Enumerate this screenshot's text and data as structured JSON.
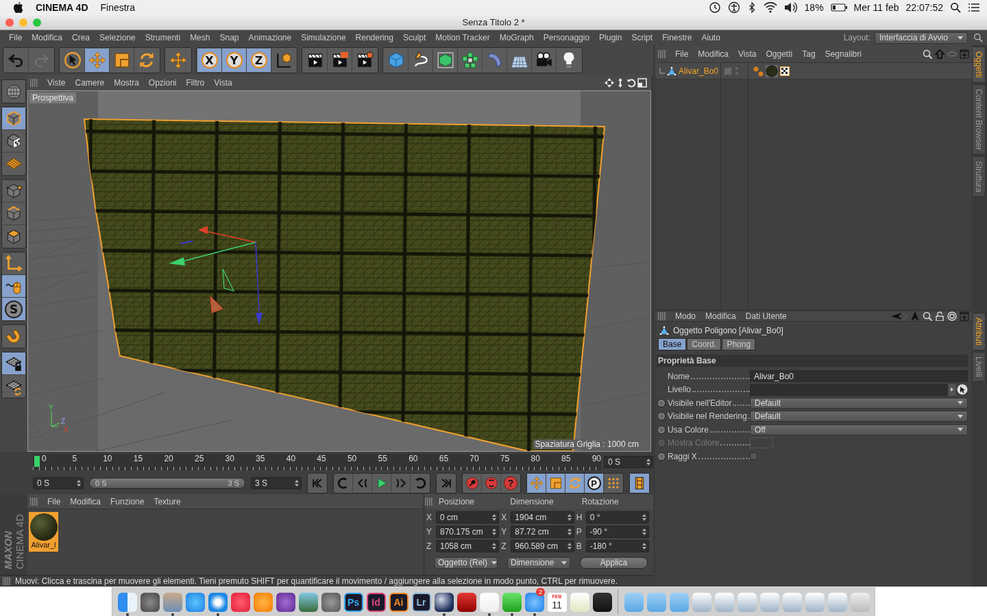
{
  "menubar": {
    "app_name": "CINEMA 4D",
    "menus": [
      "Finestra"
    ],
    "battery": "18%",
    "date": "Mer 11 feb",
    "time": "22:07:52"
  },
  "window": {
    "title": "Senza Titolo 2 *"
  },
  "menu": [
    "File",
    "Modifica",
    "Crea",
    "Selezione",
    "Strumenti",
    "Mesh",
    "Snap",
    "Animazione",
    "Simulazione",
    "Rendering",
    "Sculpt",
    "Motion Tracker",
    "MoGraph",
    "Personaggio",
    "Plugin",
    "Script",
    "Finestre",
    "Aiuto"
  ],
  "layout": {
    "label": "Layout:",
    "value": "Interfaccia di Avvio"
  },
  "toolbar": [
    [
      {
        "kind": "undo",
        "selected": false,
        "disabled": false
      },
      {
        "kind": "redo",
        "selected": false,
        "disabled": true
      }
    ],
    [
      {
        "kind": "select",
        "selected": false,
        "disabled": false
      },
      {
        "kind": "move",
        "selected": true,
        "disabled": false
      },
      {
        "kind": "scale",
        "selected": false,
        "disabled": false
      },
      {
        "kind": "rotate",
        "selected": false,
        "disabled": false
      }
    ],
    [
      {
        "kind": "transform",
        "selected": false,
        "disabled": false
      }
    ],
    [
      {
        "kind": "axis-lock",
        "label": "X",
        "selected": true,
        "disabled": false
      },
      {
        "kind": "axis-lock",
        "label": "Y",
        "selected": true,
        "disabled": false
      },
      {
        "kind": "axis-lock",
        "label": "Z",
        "selected": true,
        "disabled": false
      },
      {
        "kind": "coord",
        "selected": false,
        "disabled": false
      }
    ],
    [
      {
        "kind": "render-view",
        "selected": false,
        "disabled": false
      },
      {
        "kind": "render-picture",
        "selected": false,
        "disabled": false
      },
      {
        "kind": "render-settings",
        "selected": false,
        "disabled": false
      }
    ],
    [
      {
        "kind": "cube",
        "selected": false,
        "disabled": false
      },
      {
        "kind": "pen",
        "selected": false,
        "disabled": false
      },
      {
        "kind": "subdiv",
        "selected": false,
        "disabled": false
      },
      {
        "kind": "cloner",
        "selected": false,
        "disabled": false
      },
      {
        "kind": "deformer",
        "selected": false,
        "disabled": false
      },
      {
        "kind": "floor",
        "selected": false,
        "disabled": false
      },
      {
        "kind": "camera",
        "selected": false,
        "disabled": false
      },
      {
        "kind": "light",
        "selected": false,
        "disabled": false
      }
    ]
  ],
  "left_tools": [
    [
      {
        "kind": "globe",
        "selected": false
      }
    ],
    [
      {
        "kind": "model",
        "selected": true
      },
      {
        "kind": "texture",
        "selected": false
      },
      {
        "kind": "workplane",
        "selected": false
      }
    ],
    [
      {
        "kind": "points",
        "selected": false
      },
      {
        "kind": "edges",
        "selected": false
      },
      {
        "kind": "polygons",
        "selected": false
      }
    ],
    [
      {
        "kind": "axis",
        "selected": false
      },
      {
        "kind": "tweak",
        "selected": true
      },
      {
        "kind": "snap",
        "label": "S",
        "selected": true
      }
    ],
    [
      {
        "kind": "magnet",
        "selected": false
      }
    ],
    [
      {
        "kind": "lock-plane",
        "selected": true
      },
      {
        "kind": "planar",
        "selected": false
      }
    ]
  ],
  "viewport": {
    "menu": [
      "Viste",
      "Camere",
      "Mostra",
      "Opzioni",
      "Filtro",
      "Vista"
    ],
    "camera": "Prospettiva",
    "grid_spacing": "Spaziatura Griglia : 1000 cm",
    "axis_labels": [
      "Y",
      "Z",
      "X"
    ]
  },
  "timeline": {
    "ticks": [
      "0",
      "5",
      "10",
      "15",
      "20",
      "25",
      "30",
      "35",
      "40",
      "45",
      "50",
      "55",
      "60",
      "65",
      "70",
      "75",
      "80",
      "85",
      "90"
    ],
    "current": "0 S"
  },
  "playback": {
    "start": "0 S",
    "range_start": "0 S",
    "range_end": "3 S",
    "end": "3 S",
    "groups": [
      [
        {
          "kind": "go-start",
          "selected": false
        }
      ],
      [
        {
          "kind": "loop-back",
          "selected": false
        },
        {
          "kind": "step-back",
          "selected": false
        },
        {
          "kind": "play",
          "selected": false
        },
        {
          "kind": "step-forward",
          "selected": false
        },
        {
          "kind": "loop",
          "selected": false
        }
      ],
      [
        {
          "kind": "go-end",
          "selected": false
        }
      ],
      [
        {
          "kind": "record",
          "selected": false
        },
        {
          "kind": "autokey",
          "selected": false
        },
        {
          "kind": "keyset",
          "label": "?",
          "selected": false
        }
      ],
      [
        {
          "kind": "move",
          "selected": true
        },
        {
          "kind": "scale",
          "selected": true
        },
        {
          "kind": "rotate",
          "selected": true
        },
        {
          "kind": "param",
          "label": "P",
          "selected": true
        },
        {
          "kind": "pla",
          "selected": false
        }
      ],
      [
        {
          "kind": "film",
          "selected": true
        }
      ]
    ]
  },
  "materials": {
    "menu": [
      "File",
      "Modifica",
      "Funzione",
      "Texture"
    ],
    "items": [
      {
        "name": "Alivar_l",
        "selected": true
      }
    ],
    "logo": [
      "MAXON",
      "CINEMA 4D"
    ]
  },
  "coordinates": {
    "columns": [
      "Posizione",
      "Dimensione",
      "Rotazione"
    ],
    "rows": [
      [
        {
          "axis": "X",
          "value": "0 cm"
        },
        {
          "axis": "X",
          "value": "1904 cm"
        },
        {
          "axis": "H",
          "value": "0 °"
        }
      ],
      [
        {
          "axis": "Y",
          "value": "870.175 cm"
        },
        {
          "axis": "Y",
          "value": "87.72 cm"
        },
        {
          "axis": "P",
          "value": "-90 °"
        }
      ],
      [
        {
          "axis": "Z",
          "value": "1058 cm"
        },
        {
          "axis": "Z",
          "value": "960.589 cm"
        },
        {
          "axis": "B",
          "value": "-180 °"
        }
      ]
    ],
    "mode": "Oggetto (Rel)",
    "size_mode": "Dimensione",
    "apply": "Applica"
  },
  "status_bar": "Muovi: Clicca e trascina per muovere gli elementi. Tieni premuto SHIFT per quantificare il movimento / aggiungere alla selezione in modo punto, CTRL per rimuovere.",
  "objects": {
    "menu": [
      "File",
      "Modifica",
      "Vista",
      "Oggetti",
      "Tag",
      "Segnalibri"
    ],
    "items": [
      {
        "name": "Alivar_Bo0",
        "selected": true,
        "tags": [
          {
            "kind": "phong"
          },
          {
            "kind": "material"
          },
          {
            "kind": "texture"
          }
        ]
      }
    ]
  },
  "attributes": {
    "menu": [
      "Modo",
      "Modifica",
      "Dati Utente"
    ],
    "title": "Oggetto Poligono [Alivar_Bo0]",
    "tabs": [
      {
        "label": "Base",
        "selected": true
      },
      {
        "label": "Coord.",
        "selected": false
      },
      {
        "label": "Phong",
        "selected": false
      }
    ],
    "section": "Proprietà Base",
    "fields": [
      {
        "kind": "text",
        "label": "Nome",
        "value": "Alivar_Bo0",
        "animatable": false,
        "disabled": false
      },
      {
        "kind": "link",
        "label": "Livello",
        "animatable": false,
        "disabled": false
      },
      {
        "kind": "dropdown",
        "label": "Visibile nell'Editor",
        "value": "Default",
        "animatable": true,
        "disabled": false
      },
      {
        "kind": "dropdown",
        "label": "Visibile nel Rendering",
        "value": "Default",
        "animatable": true,
        "disabled": false
      },
      {
        "kind": "dropdown",
        "label": "Usa Colore",
        "value": "Off",
        "animatable": true,
        "disabled": false
      },
      {
        "kind": "color",
        "label": "Mostra Colore",
        "animatable": true,
        "disabled": true
      },
      {
        "kind": "checkbox",
        "label": "Raggi X",
        "checked": false,
        "animatable": true,
        "disabled": false
      }
    ]
  },
  "side_tabs_top": [
    {
      "label": "Oggetti",
      "selected": true
    },
    {
      "label": "Content Browser",
      "selected": false
    },
    {
      "label": "Struttura",
      "selected": false
    }
  ],
  "side_tabs_bottom": [
    {
      "label": "Attributi",
      "selected": true
    },
    {
      "label": "Livelli",
      "selected": false
    }
  ],
  "dock": [
    {
      "kind": "finder",
      "running": true
    },
    {
      "kind": "launchpad",
      "running": false
    },
    {
      "kind": "preview",
      "running": true
    },
    {
      "kind": "appstore",
      "running": false
    },
    {
      "kind": "safari",
      "running": true
    },
    {
      "kind": "music",
      "running": false
    },
    {
      "kind": "books",
      "running": false
    },
    {
      "kind": "movie",
      "running": false
    },
    {
      "kind": "photo",
      "running": false
    },
    {
      "kind": "prefs",
      "running": false
    },
    {
      "kind": "letters",
      "label": "Ps",
      "color": "#30a8f0",
      "running": false
    },
    {
      "kind": "letters",
      "label": "Id",
      "color": "#e0457b",
      "running": false
    },
    {
      "kind": "letters",
      "label": "Ai",
      "color": "#f58a1f",
      "running": false
    },
    {
      "kind": "letters",
      "label": "Lr",
      "color": "#8fb8d8",
      "running": false
    },
    {
      "kind": "sphere",
      "running": true
    },
    {
      "kind": "cad",
      "running": false
    },
    {
      "kind": "pdf",
      "running": true
    },
    {
      "kind": "facetime",
      "running": true
    },
    {
      "kind": "messages",
      "badge": "2",
      "running": true
    },
    {
      "kind": "calendar",
      "month": "FEB",
      "day": "11",
      "running": false
    },
    {
      "kind": "viewer",
      "running": false
    },
    {
      "kind": "dark",
      "running": false
    },
    {
      "kind": "separator"
    },
    {
      "kind": "folder",
      "running": false
    },
    {
      "kind": "folder",
      "running": false
    },
    {
      "kind": "folder",
      "running": false
    },
    {
      "kind": "thumb",
      "running": false
    },
    {
      "kind": "thumb",
      "running": false
    },
    {
      "kind": "thumb",
      "running": false
    },
    {
      "kind": "thumb",
      "running": false
    },
    {
      "kind": "thumb",
      "running": false
    },
    {
      "kind": "thumb",
      "running": false
    },
    {
      "kind": "thumb",
      "running": false
    },
    {
      "kind": "trash",
      "running": false
    }
  ]
}
